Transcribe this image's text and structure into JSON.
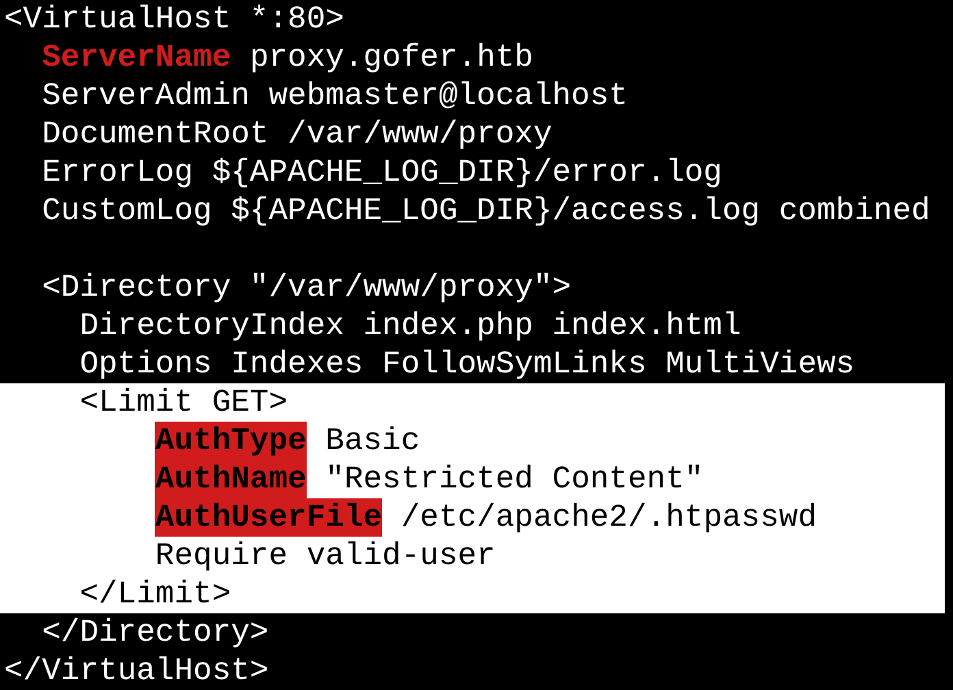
{
  "lines": [
    {
      "kind": "code",
      "highlighted": false,
      "segments": [
        {
          "kind": "text",
          "text": "<VirtualHost *:80>"
        }
      ],
      "children": [
        {
          "kind": "code",
          "highlighted": false,
          "segments": [
            {
              "kind": "directive",
              "text": "ServerName"
            },
            {
              "kind": "text",
              "text": "proxy.gofer.htb"
            }
          ]
        },
        {
          "kind": "code",
          "highlighted": false,
          "segments": [
            {
              "kind": "text",
              "text": "ServerAdmin webmaster@localhost"
            }
          ]
        },
        {
          "kind": "code",
          "highlighted": false,
          "segments": [
            {
              "kind": "text",
              "text": "DocumentRoot /var/www/proxy"
            }
          ]
        },
        {
          "kind": "code",
          "highlighted": false,
          "segments": [
            {
              "kind": "text",
              "text": "ErrorLog ${APACHE_LOG_DIR}/error.log"
            }
          ]
        },
        {
          "kind": "code",
          "highlighted": false,
          "segments": [
            {
              "kind": "text",
              "text": "CustomLog ${APACHE_LOG_DIR}/access.log combined"
            }
          ]
        },
        {
          "kind": "blank",
          "highlighted": false
        },
        {
          "kind": "code",
          "highlighted": false,
          "segments": [
            {
              "kind": "text",
              "text": "<Directory \"/var/www/proxy\">"
            }
          ],
          "children": [
            {
              "kind": "code",
              "highlighted": false,
              "segments": [
                {
                  "kind": "text",
                  "text": "DirectoryIndex index.php index.html"
                }
              ]
            },
            {
              "kind": "code",
              "highlighted": false,
              "segments": [
                {
                  "kind": "text",
                  "text": "Options Indexes FollowSymLinks MultiViews"
                }
              ]
            },
            {
              "kind": "code",
              "highlighted": true,
              "segments": [
                {
                  "kind": "text",
                  "text": "<Limit GET>"
                }
              ],
              "children": [
                {
                  "kind": "code",
                  "highlighted": true,
                  "segments": [
                    {
                      "kind": "marked",
                      "text": "AuthType"
                    },
                    {
                      "kind": "text",
                      "text": "Basic"
                    }
                  ]
                },
                {
                  "kind": "code",
                  "highlighted": true,
                  "segments": [
                    {
                      "kind": "marked",
                      "text": "AuthName"
                    },
                    {
                      "kind": "text",
                      "text": "\"Restricted Content\""
                    }
                  ]
                },
                {
                  "kind": "code",
                  "highlighted": true,
                  "segments": [
                    {
                      "kind": "marked",
                      "text": "AuthUserFile"
                    },
                    {
                      "kind": "text",
                      "text": "/etc/apache2/.htpasswd"
                    }
                  ]
                },
                {
                  "kind": "code",
                  "highlighted": true,
                  "segments": [
                    {
                      "kind": "text",
                      "text": "Require valid-user"
                    }
                  ]
                }
              ]
            },
            {
              "kind": "code",
              "highlighted": true,
              "segments": [
                {
                  "kind": "text",
                  "text": "</Limit>"
                }
              ]
            }
          ]
        },
        {
          "kind": "code",
          "highlighted": false,
          "segments": [
            {
              "kind": "text",
              "text": "</Directory>"
            }
          ]
        }
      ]
    },
    {
      "kind": "code",
      "highlighted": false,
      "segments": [
        {
          "kind": "text",
          "text": "</VirtualHost>"
        }
      ]
    }
  ]
}
